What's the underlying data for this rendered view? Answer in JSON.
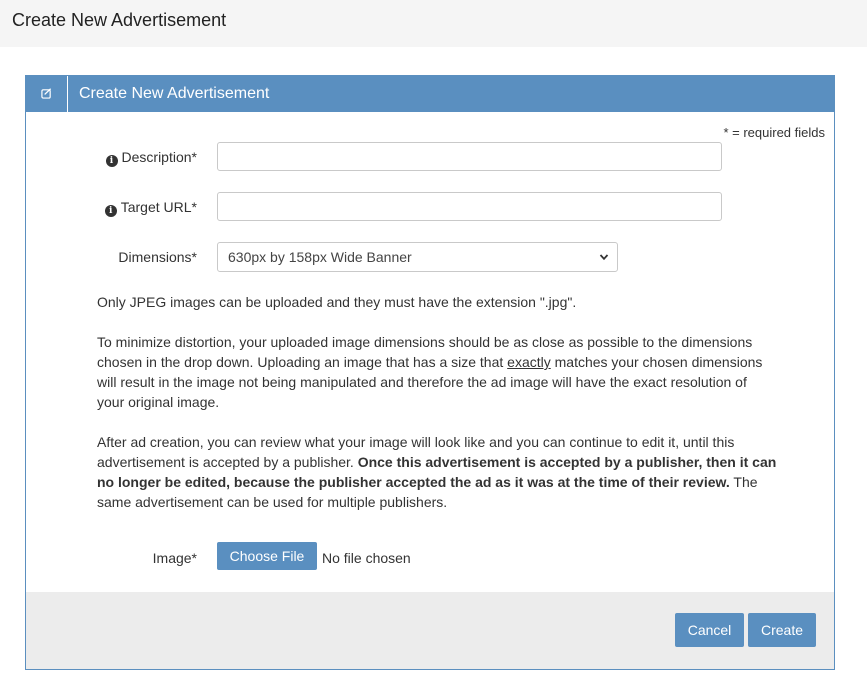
{
  "page": {
    "title": "Create New Advertisement"
  },
  "panel": {
    "title": "Create New Advertisement",
    "icon": "edit-square-icon",
    "required_note": "* = required fields"
  },
  "form": {
    "description": {
      "label": "Description*",
      "value": "",
      "placeholder": ""
    },
    "target_url": {
      "label": "Target URL*",
      "value": "",
      "placeholder": ""
    },
    "dimensions": {
      "label": "Dimensions*",
      "selected": "630px by 158px Wide Banner"
    },
    "image": {
      "label": "Image*",
      "button_label": "Choose File",
      "status": "No file chosen"
    }
  },
  "help": {
    "p1": "Only JPEG images can be uploaded and they must have the extension \".jpg\".",
    "p2_before": "To minimize distortion, your uploaded image dimensions should be as close as possible to the dimensions chosen in the drop down. Uploading an image that has a size that ",
    "p2_emphasis": "exactly",
    "p2_after": " matches your chosen dimensions will result in the image not being manipulated and therefore the ad image will have the exact resolution of your original image.",
    "p3_before": "After ad creation, you can review what your image will look like and you can continue to edit it, until this advertisement is accepted by a publisher. ",
    "p3_bold": "Once this advertisement is accepted by a publisher, then it can no longer be edited, because the publisher accepted the ad as it was at the time of their review.",
    "p3_after": " The same advertisement can be used for multiple publishers."
  },
  "footer": {
    "cancel_label": "Cancel",
    "create_label": "Create"
  },
  "colors": {
    "accent": "#5a8fc0",
    "header_bg": "#f5f5f5",
    "footer_bg": "#ececec"
  }
}
